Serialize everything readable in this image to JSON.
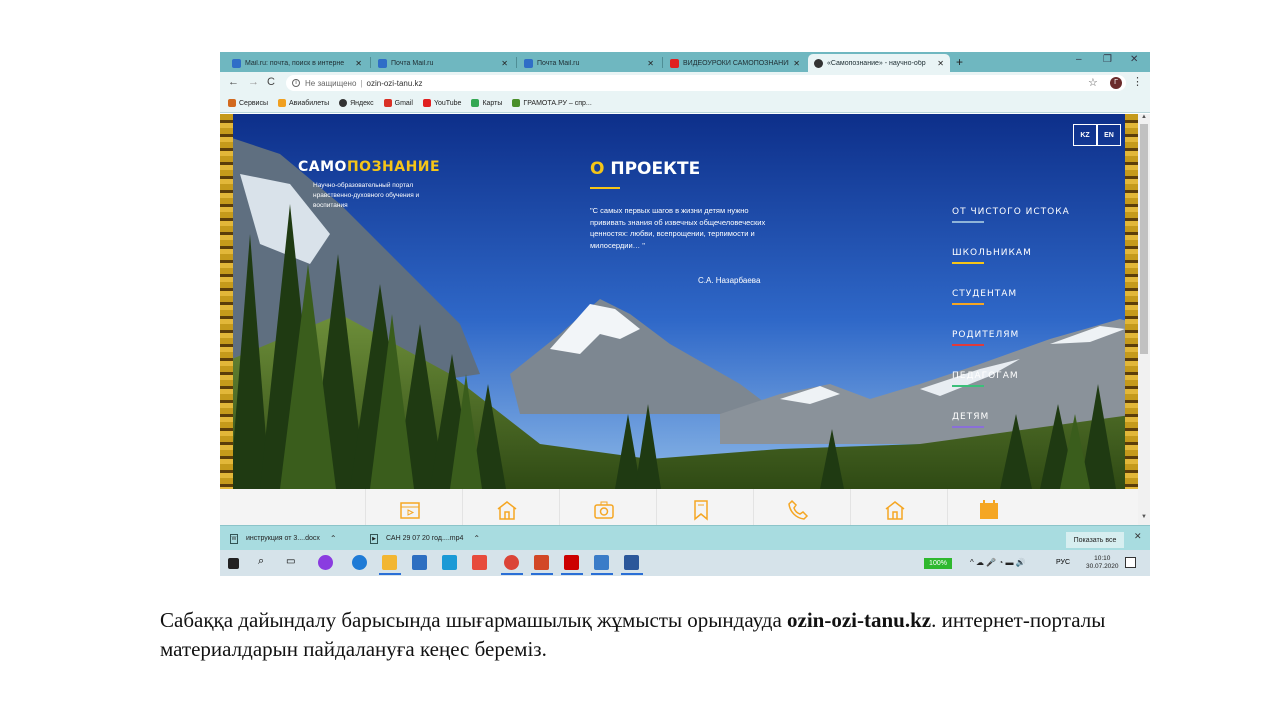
{
  "browser": {
    "tabs": [
      {
        "title": "Mail.ru: почта, поиск в интерне",
        "favicon": "mailru-icon",
        "color": "#2f6ec7",
        "active": false
      },
      {
        "title": "Почта Mail.ru",
        "favicon": "envelope-icon",
        "color": "#2f6ec7",
        "active": false
      },
      {
        "title": "Почта Mail.ru",
        "favicon": "envelope-icon",
        "color": "#2f6ec7",
        "active": false
      },
      {
        "title": "ВИДЕОУРОКИ САМОПОЗНАНИЕ",
        "favicon": "youtube-icon",
        "color": "#e02020",
        "active": false
      },
      {
        "title": "«Самопознание» - научно-обр",
        "favicon": "globe-icon",
        "color": "#333333",
        "active": true
      }
    ],
    "new_tab": "+",
    "address": {
      "security": "Не защищено",
      "separator": "|",
      "url": "ozin-ozi-tanu.kz"
    },
    "profile_initial": "Г",
    "bookmarks": [
      {
        "label": "Сервисы",
        "icon": "apps-grid-icon",
        "color": "#d2691e"
      },
      {
        "label": "Авиабилеты",
        "icon": "plane-icon",
        "color": "#f0a020"
      },
      {
        "label": "Яндекс",
        "icon": "globe-icon",
        "color": "#333333"
      },
      {
        "label": "Gmail",
        "icon": "gmail-icon",
        "color": "#d93025"
      },
      {
        "label": "YouTube",
        "icon": "youtube-icon",
        "color": "#e02020"
      },
      {
        "label": "Карты",
        "icon": "maps-icon",
        "color": "#34a853"
      },
      {
        "label": "ГРАМОТА.РУ – спр...",
        "icon": "gramota-icon",
        "color": "#4a8f2a"
      }
    ]
  },
  "site": {
    "brand_a": "САМО",
    "brand_b": "ПОЗНАНИЕ",
    "brand_sub": "Научно-образовательный портал нравственно-духовного обучения и воспитания",
    "about_prefix": "О",
    "about_title": "ПРОЕКТЕ",
    "quote": "\"С самых первых шагов в жизни детям нужно прививать знания об извечных общечеловеческих ценностях: любви, всепрощении, терпимости и милосердии… \"",
    "author": "С.А. Назарбаева",
    "languages": [
      "KZ",
      "EN"
    ],
    "menu": [
      {
        "label": "ОТ ЧИСТОГО ИСТОКА",
        "color": "#8fb4d8"
      },
      {
        "label": "ШКОЛЬНИКАМ",
        "color": "#f5c518"
      },
      {
        "label": "СТУДЕНТАМ",
        "color": "#f5a623"
      },
      {
        "label": "РОДИТЕЛЯМ",
        "color": "#e03b3b"
      },
      {
        "label": "ПЕДАГОГАМ",
        "color": "#3bbf7a"
      },
      {
        "label": "ДЕТЯМ",
        "color": "#8a6fd8"
      }
    ],
    "bottom_icons": [
      "film-icon",
      "home-icon",
      "camera-icon",
      "bookmark-icon",
      "phone-icon",
      "home-icon",
      "calendar-icon"
    ],
    "accent": "#f5c518"
  },
  "downloads": {
    "items": [
      {
        "name": "инструкция от 3....docx",
        "icon": "doc-file-icon"
      },
      {
        "name": "САН 29 07 20 год....mp4",
        "icon": "video-file-icon"
      }
    ],
    "show_all": "Показать все"
  },
  "taskbar": {
    "battery": "100%",
    "language": "РУС",
    "time": "10:10",
    "date": "30.07.2020"
  },
  "caption": {
    "before": "Сабаққа дайындалу барысында шығармашылық жұмысты орындауда ",
    "bold": "ozin-ozi-tanu.kz",
    "after": ". интернет-порталы материалдарын пайдалануға кеңес береміз."
  }
}
